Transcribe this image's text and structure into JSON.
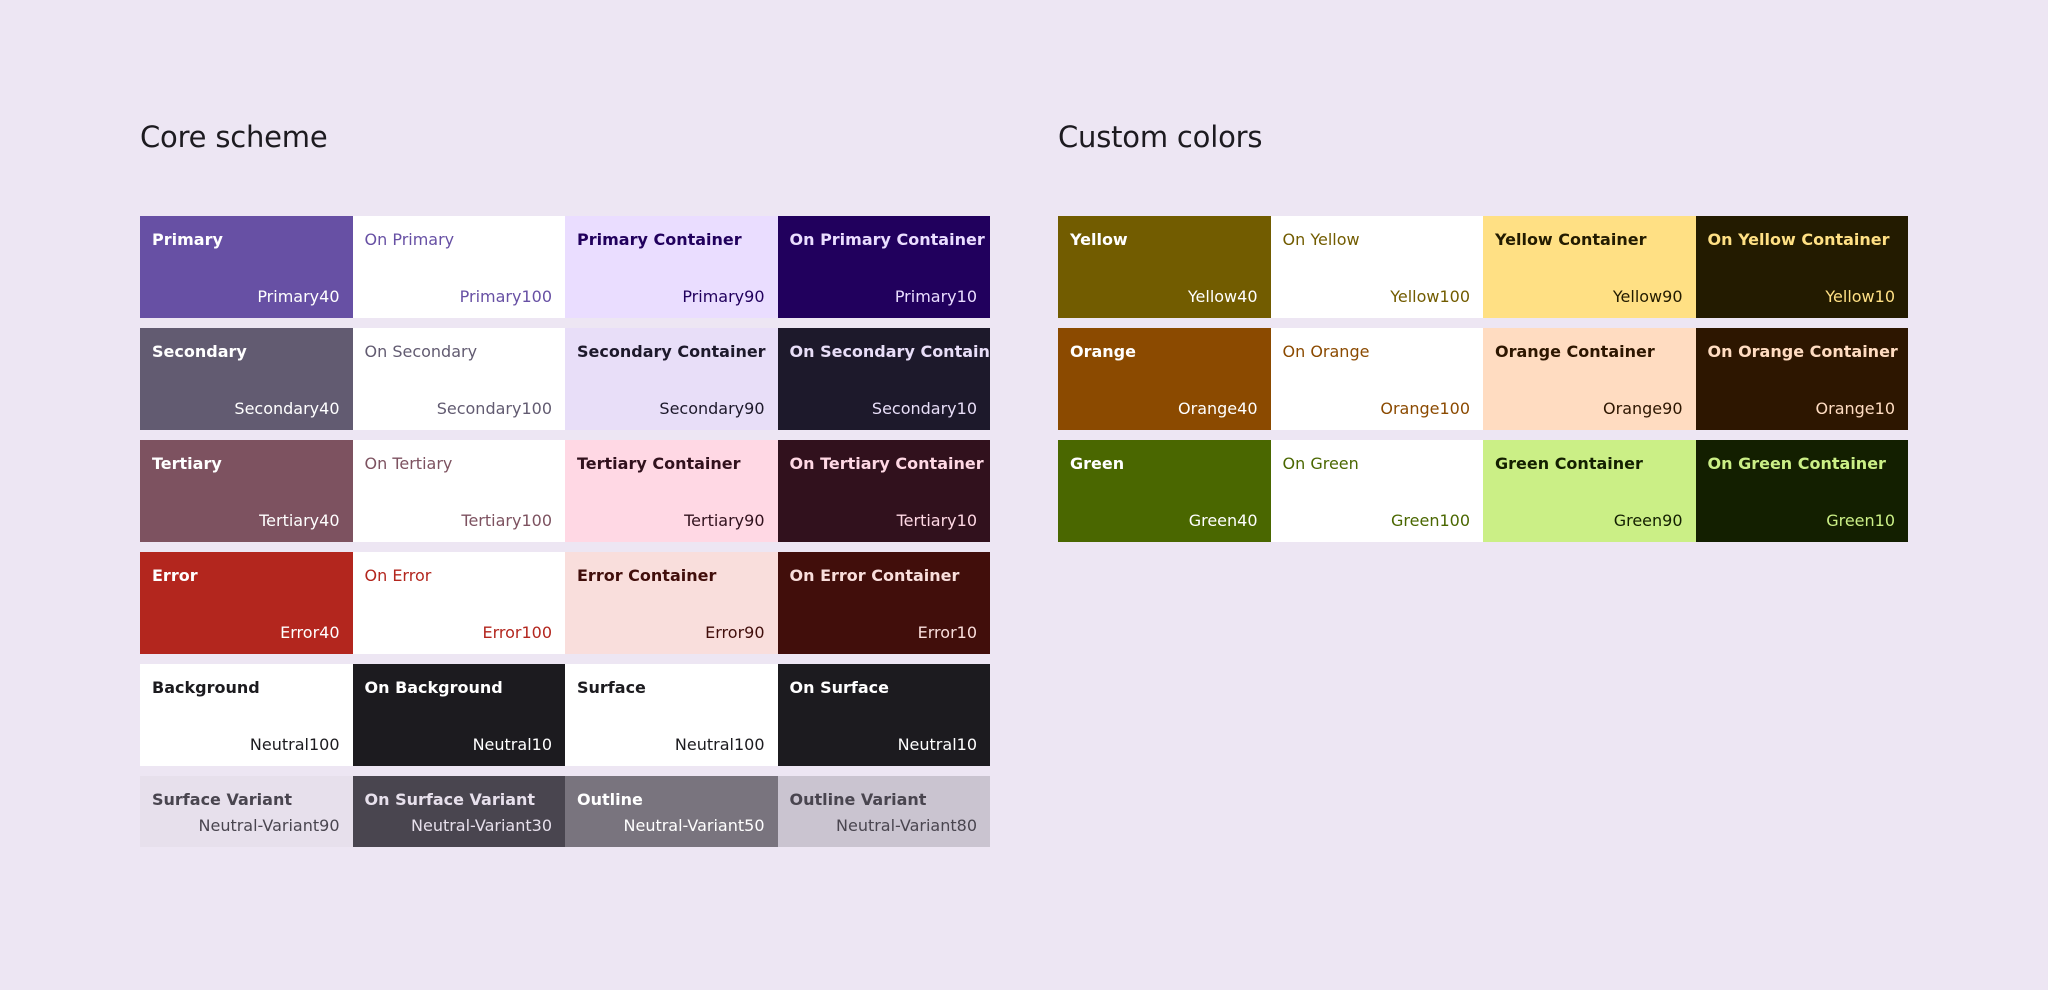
{
  "core": {
    "title": "Core scheme",
    "rows": [
      {
        "compact": false,
        "swatches": [
          {
            "name": "Primary",
            "tone": "Primary40",
            "bg": "#6750a4",
            "fg": "#ffffff",
            "bold": true
          },
          {
            "name": "On Primary",
            "tone": "Primary100",
            "bg": "#ffffff",
            "fg": "#6750a4",
            "bold": false
          },
          {
            "name": "Primary Container",
            "tone": "Primary90",
            "bg": "#eaddff",
            "fg": "#21005d",
            "bold": true
          },
          {
            "name": "On Primary Container",
            "tone": "Primary10",
            "bg": "#21005d",
            "fg": "#eaddff",
            "bold": true
          }
        ]
      },
      {
        "compact": false,
        "swatches": [
          {
            "name": "Secondary",
            "tone": "Secondary40",
            "bg": "#625b71",
            "fg": "#ffffff",
            "bold": true
          },
          {
            "name": "On Secondary",
            "tone": "Secondary100",
            "bg": "#ffffff",
            "fg": "#625b71",
            "bold": false
          },
          {
            "name": "Secondary Container",
            "tone": "Secondary90",
            "bg": "#e8def8",
            "fg": "#1d192b",
            "bold": true
          },
          {
            "name": "On Secondary Container",
            "tone": "Secondary10",
            "bg": "#1d192b",
            "fg": "#e8def8",
            "bold": true
          }
        ]
      },
      {
        "compact": false,
        "swatches": [
          {
            "name": "Tertiary",
            "tone": "Tertiary40",
            "bg": "#7d5260",
            "fg": "#ffffff",
            "bold": true
          },
          {
            "name": "On Tertiary",
            "tone": "Tertiary100",
            "bg": "#ffffff",
            "fg": "#7d5260",
            "bold": false
          },
          {
            "name": "Tertiary Container",
            "tone": "Tertiary90",
            "bg": "#ffd8e4",
            "fg": "#31111d",
            "bold": true
          },
          {
            "name": "On Tertiary Container",
            "tone": "Tertiary10",
            "bg": "#31111d",
            "fg": "#ffd8e4",
            "bold": true
          }
        ]
      },
      {
        "compact": false,
        "swatches": [
          {
            "name": "Error",
            "tone": "Error40",
            "bg": "#b3261e",
            "fg": "#ffffff",
            "bold": true
          },
          {
            "name": "On Error",
            "tone": "Error100",
            "bg": "#ffffff",
            "fg": "#b3261e",
            "bold": false
          },
          {
            "name": "Error Container",
            "tone": "Error90",
            "bg": "#f9dedc",
            "fg": "#410e0b",
            "bold": true
          },
          {
            "name": "On Error Container",
            "tone": "Error10",
            "bg": "#410e0b",
            "fg": "#f9dedc",
            "bold": true
          }
        ]
      },
      {
        "compact": false,
        "swatches": [
          {
            "name": "Background",
            "tone": "Neutral100",
            "bg": "#ffffff",
            "fg": "#1c1b1f",
            "bold": true
          },
          {
            "name": "On Background",
            "tone": "Neutral10",
            "bg": "#1c1b1f",
            "fg": "#ffffff",
            "bold": true
          },
          {
            "name": "Surface",
            "tone": "Neutral100",
            "bg": "#ffffff",
            "fg": "#1c1b1f",
            "bold": true
          },
          {
            "name": "On Surface",
            "tone": "Neutral10",
            "bg": "#1c1b1f",
            "fg": "#ffffff",
            "bold": true
          }
        ]
      },
      {
        "compact": true,
        "swatches": [
          {
            "name": "Surface Variant",
            "tone": "Neutral-Variant90",
            "bg": "#e7e0ec",
            "fg": "#49454f",
            "bold": true
          },
          {
            "name": "On Surface Variant",
            "tone": "Neutral-Variant30",
            "bg": "#49454f",
            "fg": "#e7e0ec",
            "bold": true
          },
          {
            "name": "Outline",
            "tone": "Neutral-Variant50",
            "bg": "#79747e",
            "fg": "#ffffff",
            "bold": true
          },
          {
            "name": "Outline Variant",
            "tone": "Neutral-Variant80",
            "bg": "#cac4d0",
            "fg": "#49454f",
            "bold": true
          }
        ]
      }
    ]
  },
  "custom": {
    "title": "Custom colors",
    "rows": [
      {
        "compact": false,
        "swatches": [
          {
            "name": "Yellow",
            "tone": "Yellow40",
            "bg": "#725c00",
            "fg": "#ffffff",
            "bold": true
          },
          {
            "name": "On Yellow",
            "tone": "Yellow100",
            "bg": "#ffffff",
            "fg": "#725c00",
            "bold": false
          },
          {
            "name": "Yellow Container",
            "tone": "Yellow90",
            "bg": "#ffe084",
            "fg": "#231b00",
            "bold": true
          },
          {
            "name": "On Yellow Container",
            "tone": "Yellow10",
            "bg": "#231b00",
            "fg": "#ffe084",
            "bold": true
          }
        ]
      },
      {
        "compact": false,
        "swatches": [
          {
            "name": "Orange",
            "tone": "Orange40",
            "bg": "#8b4a00",
            "fg": "#ffffff",
            "bold": true
          },
          {
            "name": "On Orange",
            "tone": "Orange100",
            "bg": "#ffffff",
            "fg": "#8b4a00",
            "bold": false
          },
          {
            "name": "Orange Container",
            "tone": "Orange90",
            "bg": "#ffdcc1",
            "fg": "#2d1600",
            "bold": true
          },
          {
            "name": "On Orange Container",
            "tone": "Orange10",
            "bg": "#2d1600",
            "fg": "#ffdcc1",
            "bold": true
          }
        ]
      },
      {
        "compact": false,
        "swatches": [
          {
            "name": "Green",
            "tone": "Green40",
            "bg": "#4a6700",
            "fg": "#ffffff",
            "bold": true
          },
          {
            "name": "On Green",
            "tone": "Green100",
            "bg": "#ffffff",
            "fg": "#4a6700",
            "bold": false
          },
          {
            "name": "Green Container",
            "tone": "Green90",
            "bg": "#cbef86",
            "fg": "#131f00",
            "bold": true
          },
          {
            "name": "On Green Container",
            "tone": "Green10",
            "bg": "#131f00",
            "fg": "#cbef86",
            "bold": true
          }
        ]
      }
    ]
  }
}
